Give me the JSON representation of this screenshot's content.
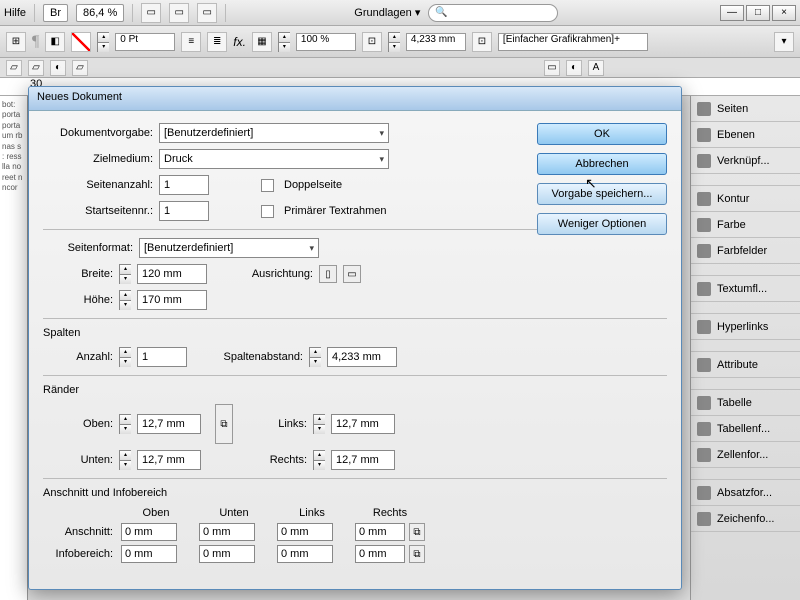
{
  "topbar": {
    "help": "Hilfe",
    "zoom": "86,4 %",
    "workspace": "Grundlagen"
  },
  "toolbar": {
    "stroke": "0 Pt",
    "opacity": "100 %",
    "width": "4,233 mm",
    "frame": "[Einfacher Grafikrahmen]+"
  },
  "ruler": {
    "val": "30"
  },
  "rightpanel": [
    "Seiten",
    "Ebenen",
    "Verknüpf...",
    "Kontur",
    "Farbe",
    "Farbfelder",
    "Textumfl...",
    "Hyperlinks",
    "Attribute",
    "Tabelle",
    "Tabellenf...",
    "Zellenfor...",
    "Absatzfor...",
    "Zeichenfo..."
  ],
  "dialog": {
    "title": "Neues Dokument",
    "preset_label": "Dokumentvorgabe:",
    "preset": "[Benutzerdefiniert]",
    "intent_label": "Zielmedium:",
    "intent": "Druck",
    "pages_label": "Seitenanzahl:",
    "pages": "1",
    "startpage_label": "Startseitennr.:",
    "startpage": "1",
    "facing": "Doppelseite",
    "primary": "Primärer Textrahmen",
    "format_label": "Seitenformat:",
    "format": "[Benutzerdefiniert]",
    "width_label": "Breite:",
    "width": "120 mm",
    "height_label": "Höhe:",
    "height": "170 mm",
    "orient_label": "Ausrichtung:",
    "columns": {
      "title": "Spalten",
      "count_label": "Anzahl:",
      "count": "1",
      "gutter_label": "Spaltenabstand:",
      "gutter": "4,233 mm"
    },
    "margins": {
      "title": "Ränder",
      "top_label": "Oben:",
      "top": "12,7 mm",
      "bottom_label": "Unten:",
      "bottom": "12,7 mm",
      "left_label": "Links:",
      "left": "12,7 mm",
      "right_label": "Rechts:",
      "right": "12,7 mm"
    },
    "bleed": {
      "title": "Anschnitt und Infobereich",
      "h_top": "Oben",
      "h_bottom": "Unten",
      "h_left": "Links",
      "h_right": "Rechts",
      "bleed_label": "Anschnitt:",
      "slug_label": "Infobereich:",
      "bleed": [
        "0 mm",
        "0 mm",
        "0 mm",
        "0 mm"
      ],
      "slug": [
        "0 mm",
        "0 mm",
        "0 mm",
        "0 mm"
      ]
    },
    "buttons": {
      "ok": "OK",
      "cancel": "Abbrechen",
      "save": "Vorgabe speichern...",
      "less": "Weniger Optionen"
    }
  },
  "doc_text": "bot:\nporta\nporta\num\nrb\nnas s\n:\nress\nlla no\nreet n\nncor"
}
